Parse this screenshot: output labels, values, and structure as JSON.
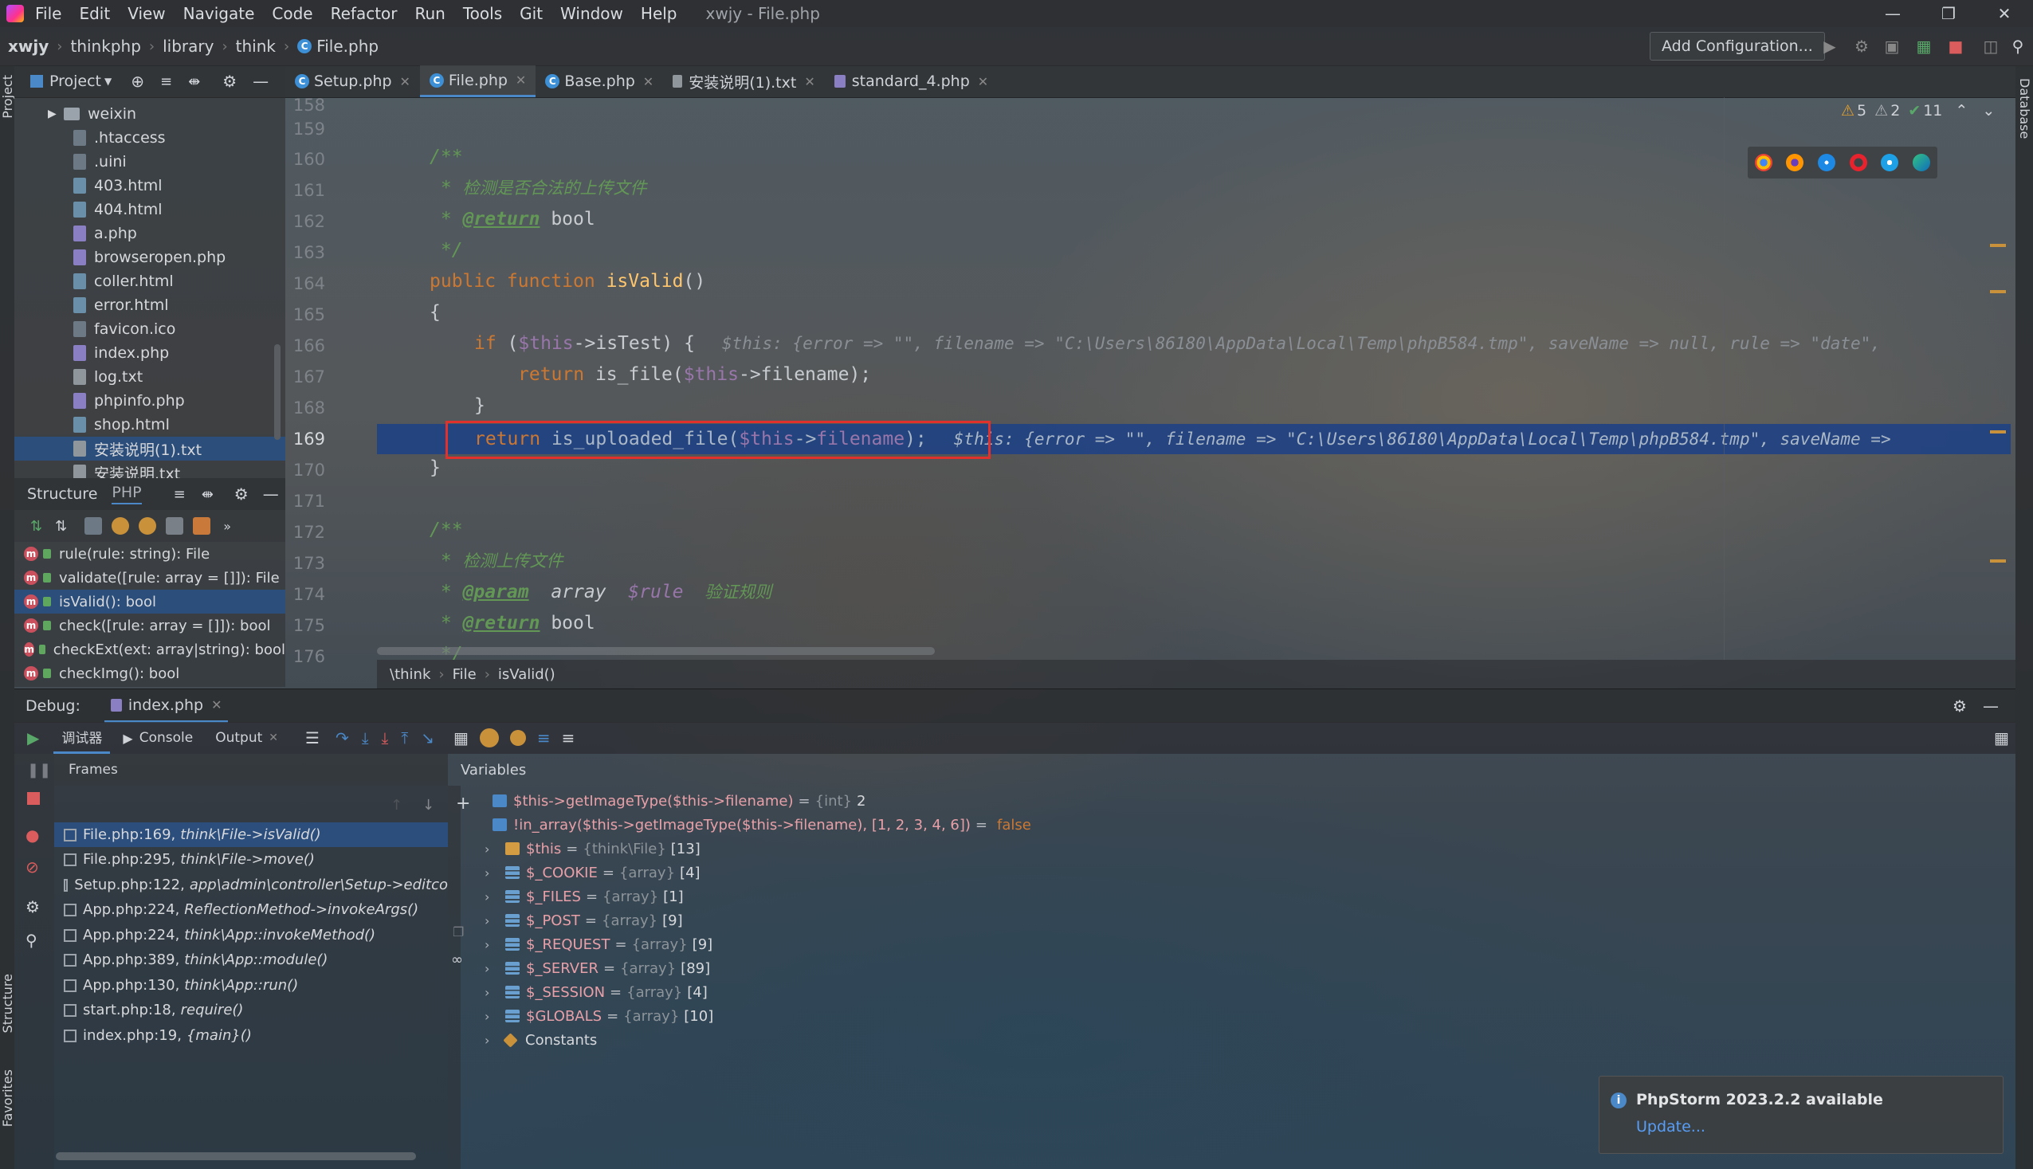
{
  "menu": {
    "items": [
      "File",
      "Edit",
      "View",
      "Navigate",
      "Code",
      "Refactor",
      "Run",
      "Tools",
      "Git",
      "Window",
      "Help"
    ],
    "window_title": "xwjy - File.php"
  },
  "navbar": {
    "crumbs": [
      "xwjy",
      "thinkphp",
      "library",
      "think",
      "File.php"
    ],
    "add_config": "Add Configuration..."
  },
  "project": {
    "title": "Project",
    "files": [
      {
        "name": "weixin",
        "type": "folder"
      },
      {
        "name": ".htaccess",
        "type": "file"
      },
      {
        "name": ".uini",
        "type": "file"
      },
      {
        "name": "403.html",
        "type": "html"
      },
      {
        "name": "404.html",
        "type": "html"
      },
      {
        "name": "a.php",
        "type": "php"
      },
      {
        "name": "browseropen.php",
        "type": "php"
      },
      {
        "name": "coller.html",
        "type": "html"
      },
      {
        "name": "error.html",
        "type": "html"
      },
      {
        "name": "favicon.ico",
        "type": "file"
      },
      {
        "name": "index.php",
        "type": "php"
      },
      {
        "name": "log.txt",
        "type": "txt"
      },
      {
        "name": "phpinfo.php",
        "type": "php"
      },
      {
        "name": "shop.html",
        "type": "html"
      },
      {
        "name": "安装说明(1).txt",
        "type": "txt"
      },
      {
        "name": "安装说明.txt",
        "type": "txt"
      }
    ]
  },
  "structure": {
    "title": "Structure",
    "lang": "PHP",
    "items": [
      "rule(rule: string): File",
      "validate([rule: array = []]): File",
      "isValid(): bool",
      "check([rule: array = []]): bool",
      "checkExt(ext: array|string): bool",
      "checkImg(): bool"
    ]
  },
  "tabs": [
    "Setup.php",
    "File.php",
    "Base.php",
    "安装说明(1).txt",
    "standard_4.php"
  ],
  "inspections": {
    "warnings": "5",
    "weak_warnings": "2",
    "ok": "11"
  },
  "gutter": {
    "line_numbers": [
      "158",
      "159",
      "160",
      "161",
      "162",
      "163",
      "164",
      "165",
      "166",
      "167",
      "168",
      "169",
      "170",
      "171",
      "172",
      "173",
      "174",
      "175",
      "176"
    ]
  },
  "code": {
    "l160": "/**",
    "l161_a": " * ",
    "l161_b": "检测是否合法的上传文件",
    "l162_a": " * ",
    "l162_tag": "@return",
    "l162_b": " bool",
    "l163": " */",
    "l164_kw": "public function ",
    "l164_fn": "isValid",
    "l164_p": "()",
    "l165": "{",
    "l166_kw": "if",
    "l166_p1": " (",
    "l166_v": "$this",
    "l166_p2": "->isTest) {",
    "l166_inline": "$this: {error => \"\", filename => \"C:\\Users\\86180\\AppData\\Local\\Temp\\phpB584.tmp\", saveName => null, rule => \"date\",",
    "l167_kw": "return",
    "l167_p1": " is_file(",
    "l167_v": "$this",
    "l167_p2": "->filename);",
    "l168": "}",
    "l169_kw": "return",
    "l169_p1": " is_uploaded_file(",
    "l169_v": "$this",
    "l169_p2": "->",
    "l169_f": "filename",
    "l169_p3": ");",
    "l169_inline": "$this: {error => \"\", filename => \"C:\\Users\\86180\\AppData\\Local\\Temp\\phpB584.tmp\", saveName =>",
    "l170": "}",
    "l172": "/**",
    "l173_a": " * ",
    "l173_b": "检测上传文件",
    "l174_a": " * ",
    "l174_tag": "@param",
    "l174_t": "  array  ",
    "l174_v": "$rule",
    "l174_d": "    验证规则",
    "l175_a": " * ",
    "l175_tag": "@return",
    "l175_b": " bool",
    "l176": " */"
  },
  "editor_breadcrumb": [
    "\\think",
    "File",
    "isValid()"
  ],
  "debug": {
    "label": "Debug:",
    "session": "index.php",
    "tabs": [
      "调试器",
      "Console",
      "Output"
    ],
    "frames_title": "Frames",
    "variables_title": "Variables",
    "frames": [
      {
        "loc": "File.php:169,",
        "fn": "think\\File->isValid()"
      },
      {
        "loc": "File.php:295,",
        "fn": "think\\File->move()"
      },
      {
        "loc": "Setup.php:122,",
        "fn": "app\\admin\\controller\\Setup->editco"
      },
      {
        "loc": "App.php:224,",
        "fn": "ReflectionMethod->invokeArgs()"
      },
      {
        "loc": "App.php:224,",
        "fn": "think\\App::invokeMethod()"
      },
      {
        "loc": "App.php:389,",
        "fn": "think\\App::module()"
      },
      {
        "loc": "App.php:130,",
        "fn": "think\\App::run()"
      },
      {
        "loc": "start.php:18,",
        "fn": "require()"
      },
      {
        "loc": "index.php:19,",
        "fn": "{main}()"
      }
    ],
    "variables": [
      {
        "name": "$this->getImageType($this->filename)",
        "type": "{int}",
        "count": "2",
        "kind": "watch"
      },
      {
        "name": "!in_array($this->getImageType($this->filename), [1, 2, 3, 4, 6])",
        "type": "",
        "count": "false",
        "kind": "watch"
      },
      {
        "name": "$this",
        "type": "{think\\File}",
        "count": "[13]",
        "kind": "obj"
      },
      {
        "name": "$_COOKIE",
        "type": "{array}",
        "count": "[4]",
        "kind": "arr"
      },
      {
        "name": "$_FILES",
        "type": "{array}",
        "count": "[1]",
        "kind": "arr"
      },
      {
        "name": "$_POST",
        "type": "{array}",
        "count": "[9]",
        "kind": "arr"
      },
      {
        "name": "$_REQUEST",
        "type": "{array}",
        "count": "[9]",
        "kind": "arr"
      },
      {
        "name": "$_SERVER",
        "type": "{array}",
        "count": "[89]",
        "kind": "arr"
      },
      {
        "name": "$_SESSION",
        "type": "{array}",
        "count": "[4]",
        "kind": "arr"
      },
      {
        "name": "$GLOBALS",
        "type": "{array}",
        "count": "[10]",
        "kind": "arr"
      },
      {
        "name": "Constants",
        "type": "",
        "count": "",
        "kind": "const"
      }
    ]
  },
  "notification": {
    "title": "PhpStorm 2023.2.2 available",
    "link": "Update..."
  },
  "side_labels": {
    "project": "Project",
    "structure": "Structure",
    "favorites": "Favorites",
    "database": "Database"
  },
  "colors": {
    "accent": "#4a88c7",
    "selection": "#214283",
    "highlight_box": "#e0312c"
  }
}
